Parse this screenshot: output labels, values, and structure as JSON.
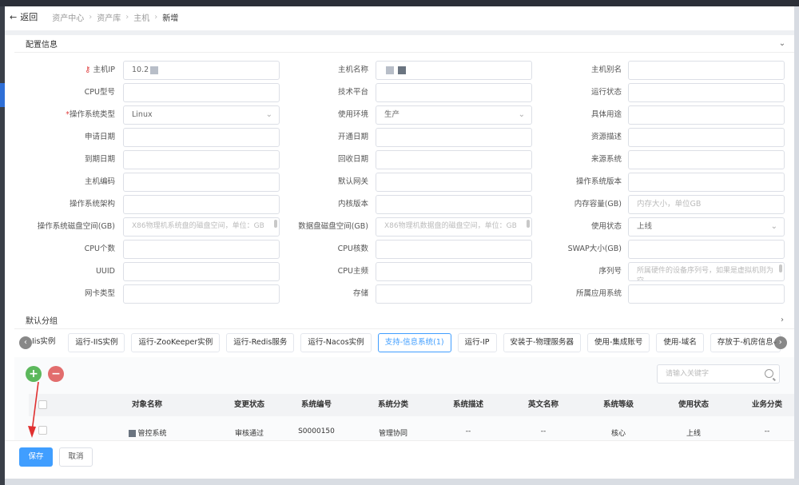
{
  "breadcrumb": {
    "back": "返回",
    "items": [
      "资产中心",
      "资产库",
      "主机"
    ],
    "current": "新增"
  },
  "sections": {
    "config": "配置信息",
    "default_group": "默认分组"
  },
  "form": {
    "host_ip_label": "主机IP",
    "host_ip_value": "10.2",
    "host_name_label": "主机名称",
    "host_alias_label": "主机别名",
    "cpu_model_label": "CPU型号",
    "tech_platform_label": "技术平台",
    "run_state_label": "运行状态",
    "os_type_label": "操作系统类型",
    "os_type_value": "Linux",
    "env_label": "使用环境",
    "env_value": "生产",
    "purpose_label": "具体用途",
    "apply_date_label": "申请日期",
    "open_date_label": "开通日期",
    "resource_desc_label": "资源描述",
    "expire_date_label": "到期日期",
    "recycle_date_label": "回收日期",
    "source_system_label": "来源系统",
    "host_code_label": "主机编码",
    "default_gateway_label": "默认网关",
    "os_version_label": "操作系统版本",
    "os_arch_label": "操作系统架构",
    "kernel_label": "内核版本",
    "memory_label": "内存容量(GB)",
    "memory_placeholder": "内存大小，单位GB",
    "os_disk_label": "操作系统磁盘空间(GB)",
    "os_disk_placeholder": "X86物理机系统盘的磁盘空间，单位：GB",
    "data_disk_label": "数据盘磁盘空间(GB)",
    "data_disk_placeholder": "X86物理机数据盘的磁盘空间，单位：GB",
    "use_state_label": "使用状态",
    "use_state_value": "上线",
    "cpu_count_label": "CPU个数",
    "cpu_cores_label": "CPU核数",
    "swap_label": "SWAP大小(GB)",
    "uuid_label": "UUID",
    "cpu_freq_label": "CPU主频",
    "serial_label": "序列号",
    "serial_placeholder": "所属硬件的设备序列号，如果是虚拟机则为空",
    "nic_label": "网卡类型",
    "storage_label": "存储",
    "app_label": "所属应用系统"
  },
  "tabs": [
    "Iis实例",
    "运行-IIS实例",
    "运行-ZooKeeper实例",
    "运行-Redis服务",
    "运行-Nacos实例",
    "支持-信息系统(1)",
    "运行-IP",
    "安装于-物理服务器",
    "使用-集成账号",
    "使用-域名",
    "存放于-机房信息"
  ],
  "active_tab_index": 5,
  "table": {
    "search_placeholder": "请输入关键字",
    "columns": [
      "对象名称",
      "变更状态",
      "系统编号",
      "系统分类",
      "系统描述",
      "英文名称",
      "系统等级",
      "使用状态",
      "业务分类"
    ],
    "rows": [
      [
        "管控系统",
        "审核通过",
        "S0000150",
        "管理协同",
        "--",
        "--",
        "核心",
        "上线",
        "--"
      ]
    ]
  },
  "footer": {
    "save": "保存",
    "cancel": "取消"
  },
  "colors": {
    "primary": "#409eff",
    "add": "#5cb85c",
    "delete": "#e26d6d",
    "annotation": "#e03030"
  }
}
